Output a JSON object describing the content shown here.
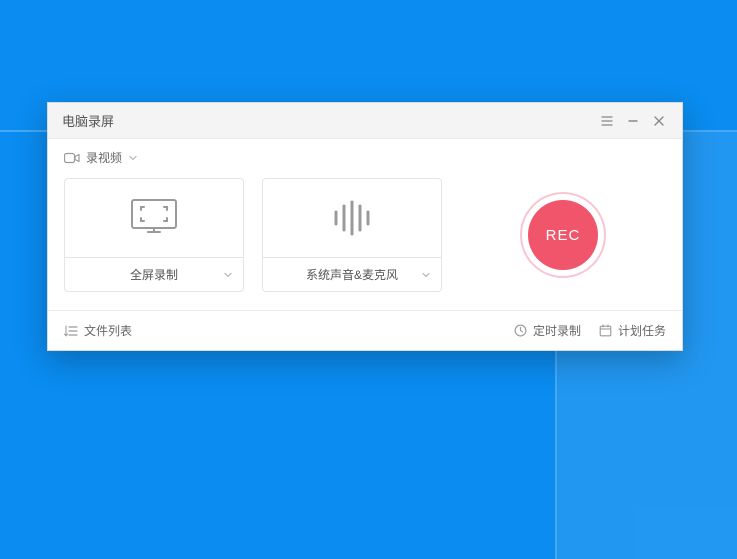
{
  "titlebar": {
    "title": "电脑录屏"
  },
  "toolbar": {
    "mode_label": "录视频"
  },
  "capture": {
    "select_label": "全屏录制"
  },
  "audio": {
    "select_label": "系统声音&麦克风"
  },
  "record": {
    "button_label": "REC"
  },
  "footer": {
    "file_list_label": "文件列表",
    "scheduled_record_label": "定时录制",
    "task_plan_label": "计划任务"
  }
}
